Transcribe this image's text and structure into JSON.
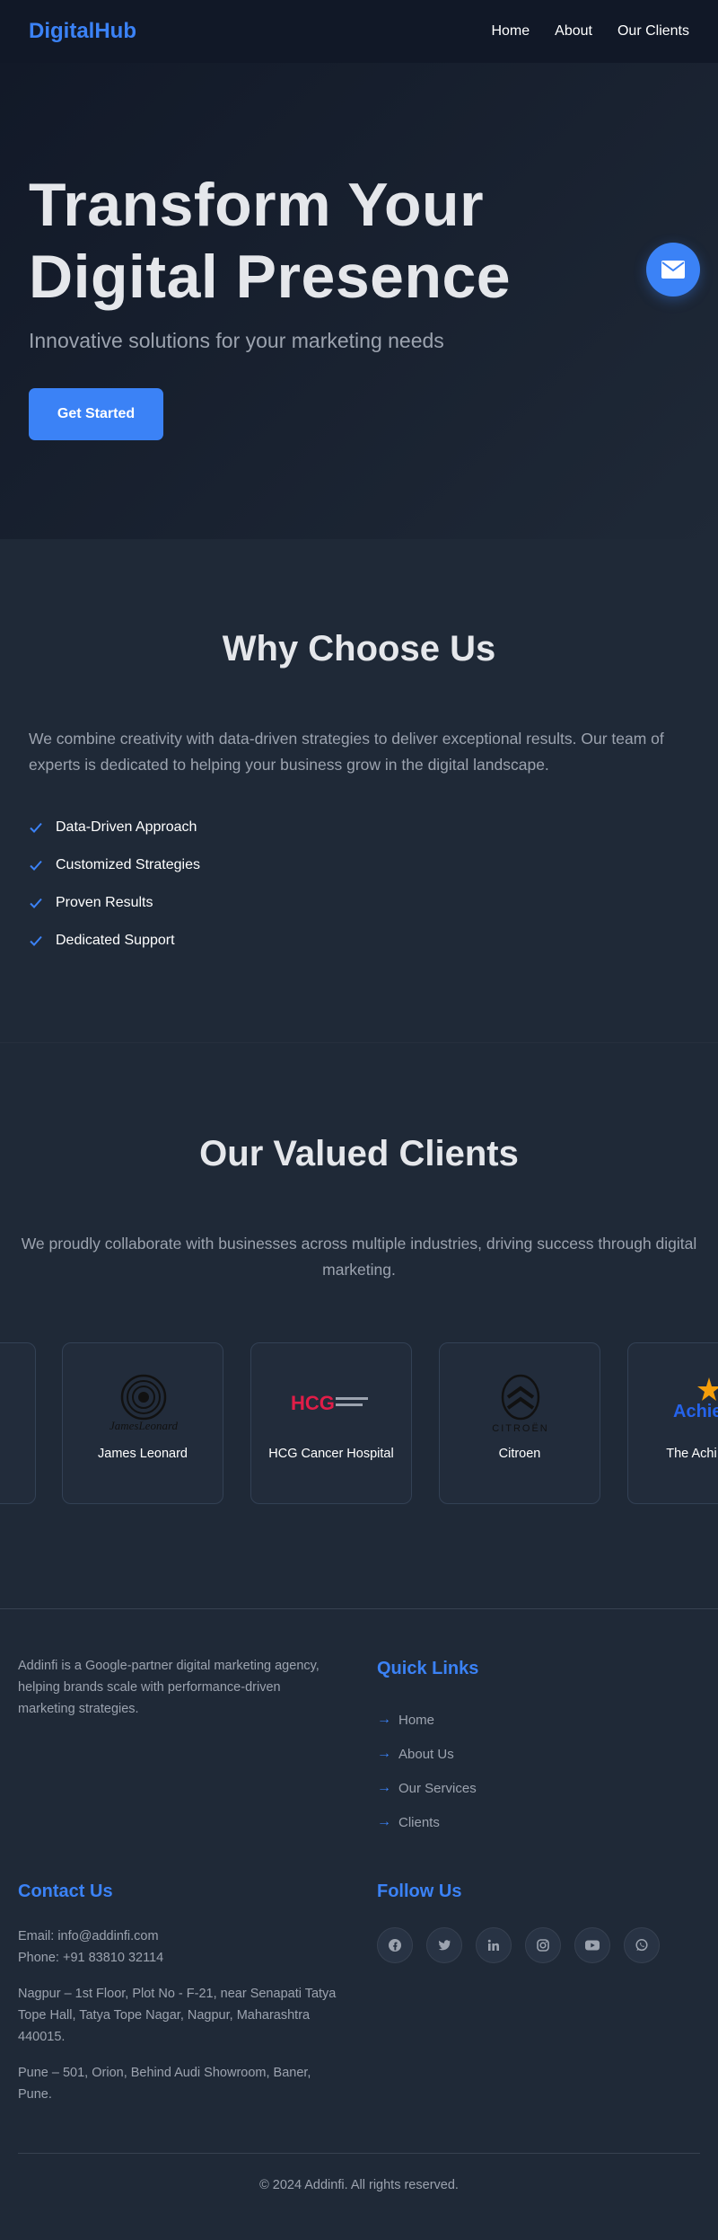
{
  "header": {
    "brand": "DigitalHub",
    "nav": [
      "Home",
      "About",
      "Our Clients"
    ]
  },
  "hero": {
    "title_line1": "Transform Your",
    "title_line2": "Digital Presence",
    "subtitle": "Innovative solutions for your marketing needs",
    "cta_label": "Get Started"
  },
  "why": {
    "title": "Why Choose Us",
    "text": "We combine creativity with data-driven strategies to deliver exceptional results. Our team of experts is dedicated to helping your business grow in the digital landscape.",
    "features": [
      "Data-Driven Approach",
      "Customized Strategies",
      "Proven Results",
      "Dedicated Support"
    ]
  },
  "clients": {
    "title": "Our Valued Clients",
    "text": "We proudly collaborate with businesses across multiple industries, driving success through digital marketing.",
    "cards": [
      {
        "name": "",
        "logo": "partial-card"
      },
      {
        "name": "James Leonard",
        "logo": "james-leonard-logo"
      },
      {
        "name": "HCG Cancer Hospital",
        "logo": "hcg-logo"
      },
      {
        "name": "Citroen",
        "logo": "citroen-logo"
      },
      {
        "name": "The Achi Scho",
        "logo": "achievers-logo"
      }
    ],
    "logo_text": {
      "james": "JamesLeonard",
      "hcg": "HCG",
      "citroen": "CITROËN",
      "achievers": "Achie"
    }
  },
  "footer": {
    "about": "Addinfi is a Google-partner digital marketing agency, helping brands scale with performance-driven marketing strategies.",
    "quick_links_title": "Quick Links",
    "quick_links": [
      "Home",
      "About Us",
      "Our Services",
      "Clients"
    ],
    "contact_title": "Contact Us",
    "email": "Email: info@addinfi.com",
    "phone": "Phone: +91 83810 32114",
    "address_nagpur": "Nagpur – 1st Floor, Plot No - F-21, near Senapati Tatya Tope Hall, Tatya Tope Nagar, Nagpur, Maharashtra 440015.",
    "address_pune": "Pune – 501, Orion, Behind Audi Showroom, Baner, Pune.",
    "follow_title": "Follow Us",
    "socials": [
      "facebook-icon",
      "twitter-icon",
      "linkedin-icon",
      "instagram-icon",
      "youtube-icon",
      "whatsapp-icon"
    ],
    "copyright": "© 2024 Addinfi. All rights reserved."
  },
  "colors": {
    "accent": "#3b82f6",
    "background": "#1f2937",
    "header": "#111827"
  }
}
